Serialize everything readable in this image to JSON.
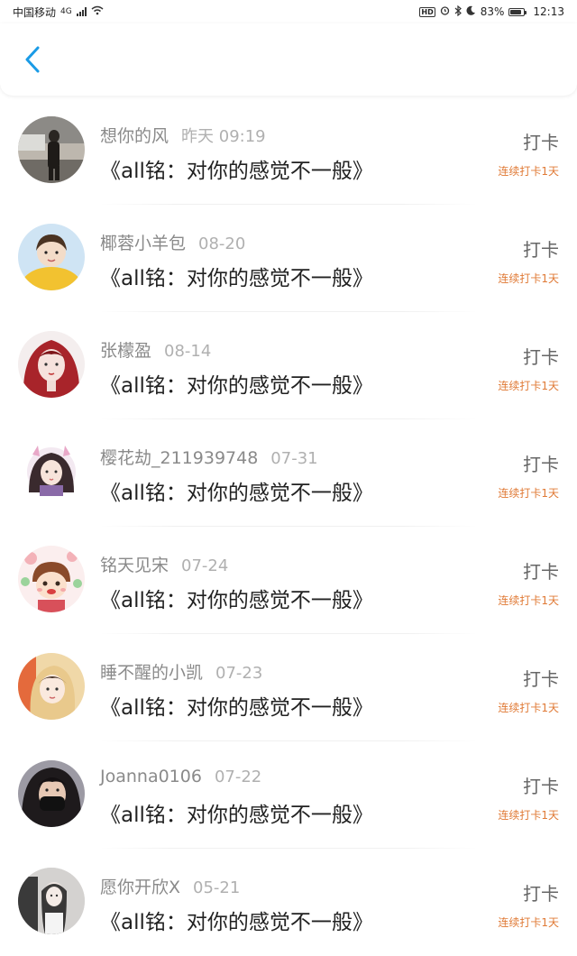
{
  "status_bar": {
    "carrier": "中国移动",
    "network": "4G",
    "battery": "83%",
    "time": "12:13"
  },
  "header": {
    "back_label": ""
  },
  "entries": [
    {
      "name": "想你的风",
      "date": "昨天 09:19",
      "title": "《all铭：对你的感觉不一般》",
      "action": "打卡",
      "streak": "连续打卡1天"
    },
    {
      "name": "椰蓉小羊包",
      "date": "08-20",
      "title": "《all铭：对你的感觉不一般》",
      "action": "打卡",
      "streak": "连续打卡1天"
    },
    {
      "name": "张檬盈",
      "date": "08-14",
      "title": "《all铭：对你的感觉不一般》",
      "action": "打卡",
      "streak": "连续打卡1天"
    },
    {
      "name": "樱花劫_211939748",
      "date": "07-31",
      "title": "《all铭：对你的感觉不一般》",
      "action": "打卡",
      "streak": "连续打卡1天"
    },
    {
      "name": "铭天见宋",
      "date": "07-24",
      "title": "《all铭：对你的感觉不一般》",
      "action": "打卡",
      "streak": "连续打卡1天"
    },
    {
      "name": "睡不醒的小凯",
      "date": "07-23",
      "title": "《all铭：对你的感觉不一般》",
      "action": "打卡",
      "streak": "连续打卡1天"
    },
    {
      "name": "Joanna0106",
      "date": "07-22",
      "title": "《all铭：对你的感觉不一般》",
      "action": "打卡",
      "streak": "连续打卡1天"
    },
    {
      "name": "愿你开欣X",
      "date": "05-21",
      "title": "《all铭：对你的感觉不一般》",
      "action": "打卡",
      "streak": "连续打卡1天"
    }
  ],
  "colors": {
    "accent": "#1a9be6",
    "streak": "#e07a36"
  }
}
